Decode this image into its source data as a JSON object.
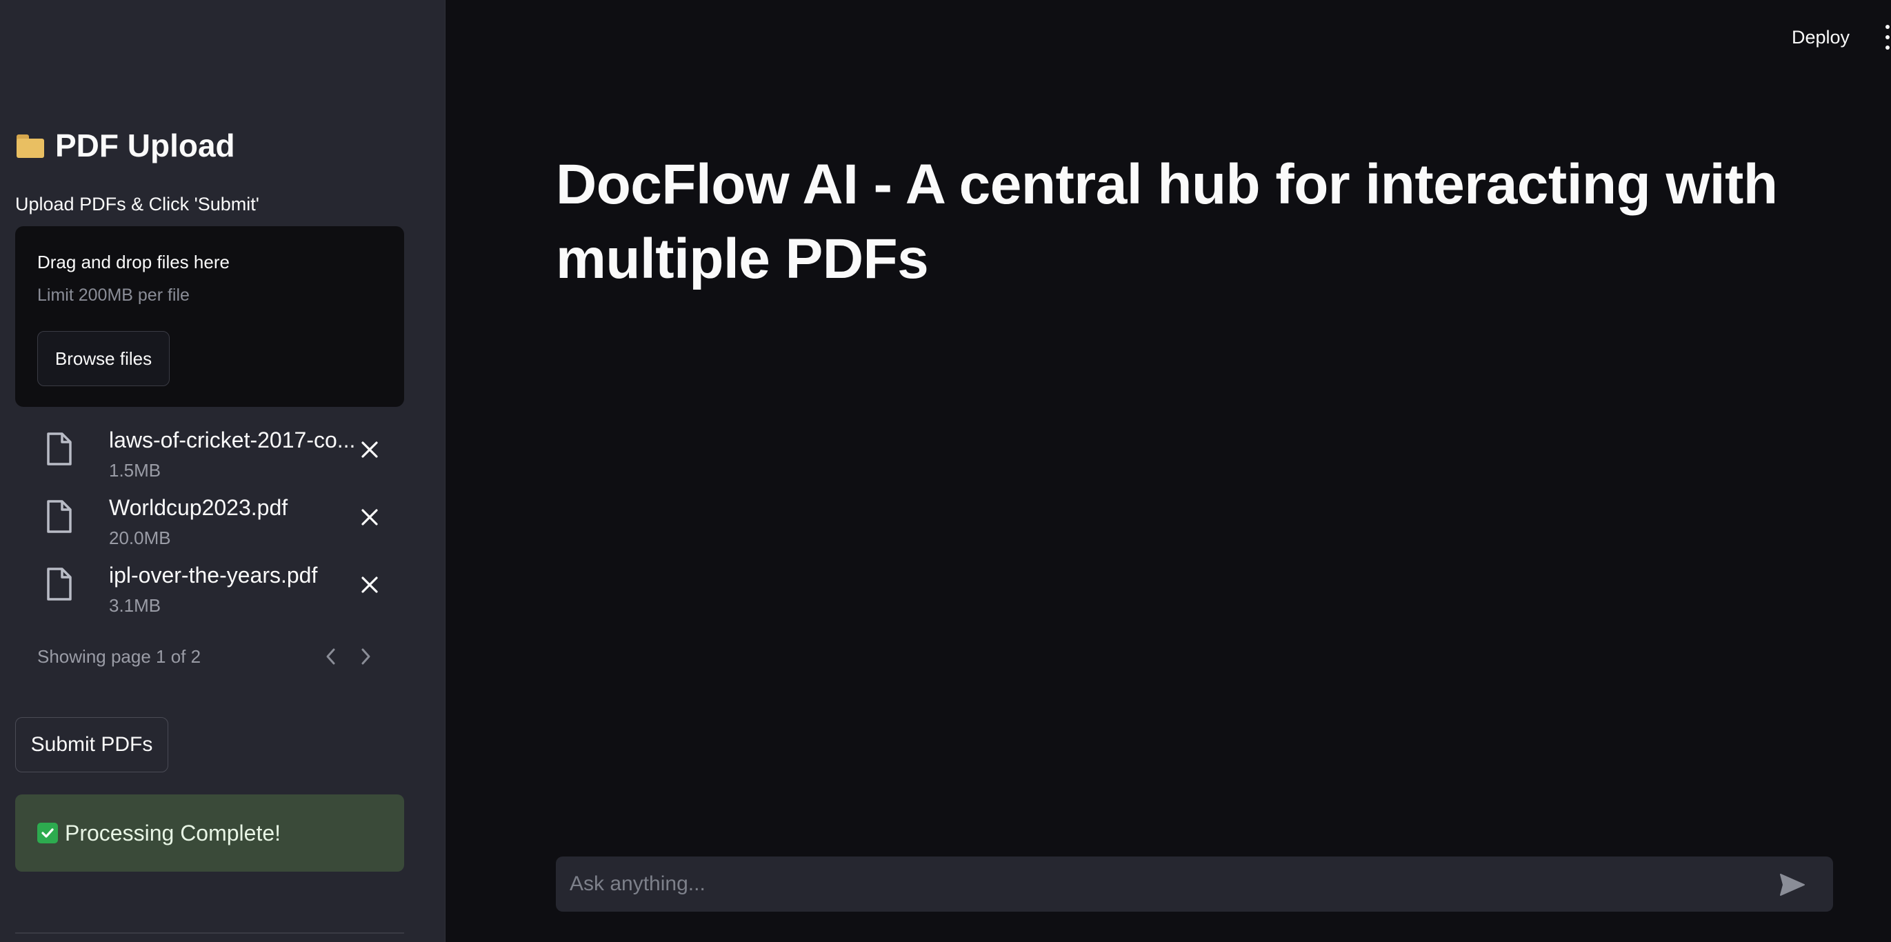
{
  "header": {
    "deploy_label": "Deploy",
    "menu_icon": "kebab-menu-icon"
  },
  "sidebar": {
    "title": "PDF Upload",
    "title_icon": "folder-icon",
    "uploader_label": "Upload PDFs & Click 'Submit'",
    "dropzone": {
      "title": "Drag and drop files here",
      "limit": "Limit 200MB per file",
      "browse_label": "Browse files"
    },
    "files": [
      {
        "name": "laws-of-cricket-2017-co...",
        "size": "1.5MB"
      },
      {
        "name": "Worldcup2023.pdf",
        "size": "20.0MB"
      },
      {
        "name": "ipl-over-the-years.pdf",
        "size": "3.1MB"
      }
    ],
    "pagination": {
      "text": "Showing page 1 of 2"
    },
    "submit_label": "Submit PDFs",
    "status": {
      "text": "Processing Complete!",
      "color": "#3a4a39"
    }
  },
  "main": {
    "title": "DocFlow AI - A central hub for interacting with multiple PDFs",
    "chat": {
      "placeholder": "Ask anything..."
    }
  }
}
